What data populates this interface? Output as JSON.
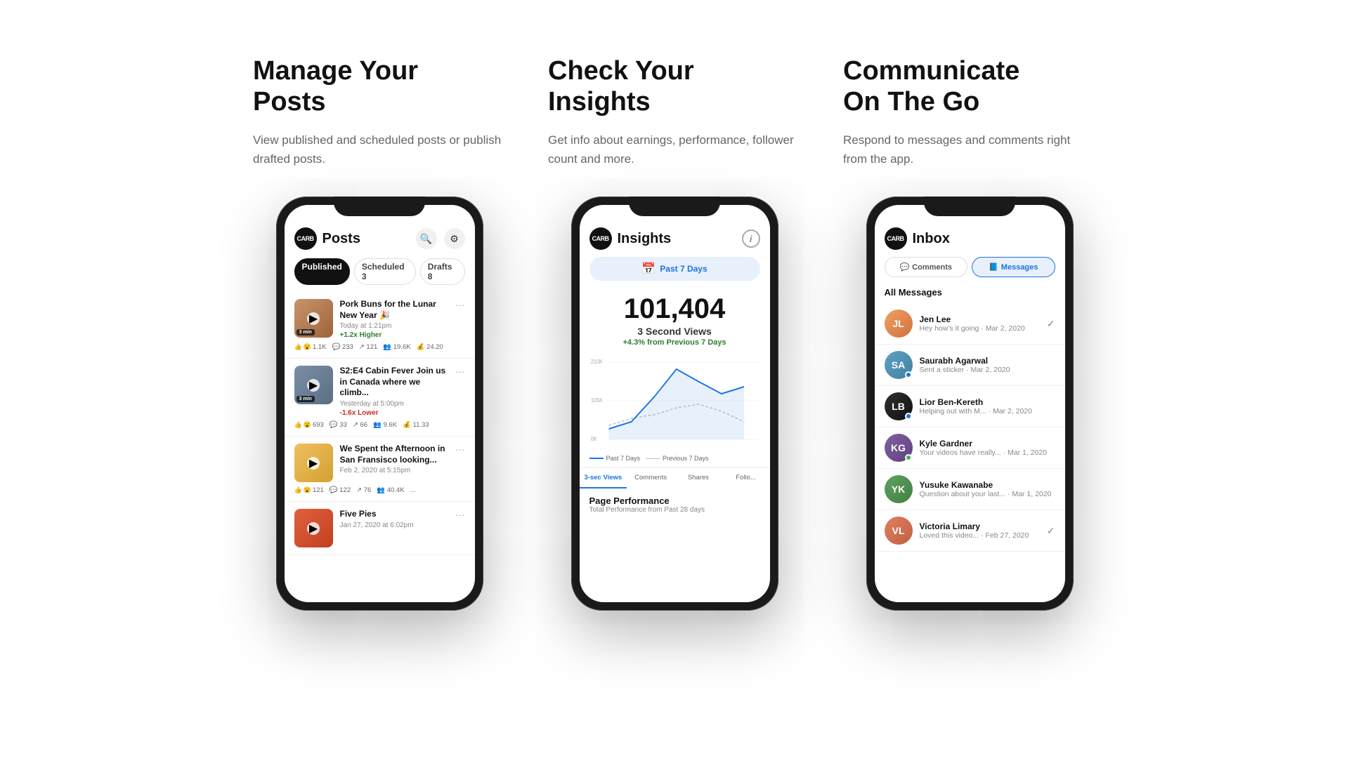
{
  "sections": [
    {
      "id": "manage-posts",
      "title": "Manage Your\nPosts",
      "description": "View published and scheduled posts or publish drafted posts."
    },
    {
      "id": "check-insights",
      "title": "Check Your\nInsights",
      "description": "Get info about earnings, performance, follower count and more."
    },
    {
      "id": "communicate",
      "title": "Communicate\nOn The Go",
      "description": "Respond to messages and comments right from the app."
    }
  ],
  "posts_phone": {
    "logo": "CARB",
    "title": "Posts",
    "search_icon": "🔍",
    "filter_icon": "⚙",
    "tabs": [
      {
        "label": "Published",
        "active": true
      },
      {
        "label": "Scheduled 3",
        "active": false
      },
      {
        "label": "Drafts 8",
        "active": false
      }
    ],
    "posts": [
      {
        "title": "Pork Buns for the Lunar New Year 🎉",
        "date": "Today at 1:21pm",
        "performance": "+1.2x Higher",
        "perf_type": "high",
        "thumb_type": "brown",
        "duration": "3 min",
        "stats": "👍😮 1.1K  💬 233  ↗ 121  👥 19.6K  💰 24.20"
      },
      {
        "title": "S2:E4 Cabin Fever Join us in Canada where we climb...",
        "date": "Yesterday at 5:00pm",
        "performance": "-1.6x Lower",
        "perf_type": "low",
        "thumb_type": "blue-gray",
        "duration": "3 min",
        "stats": "👍😮 693  💬 33  ↗ 66  👥 9.6K  💰 11.33"
      },
      {
        "title": "We Spent the Afternoon in San Fransisco looking...",
        "date": "Feb 2, 2020 at 5:15pm",
        "performance": "",
        "perf_type": "",
        "thumb_type": "yellow",
        "duration": "",
        "stats": "👍😮 121  💬 122  ↗ 76  👥 40.4K  ..."
      },
      {
        "title": "Five Pies",
        "date": "Jan 27, 2020 at 6:02pm",
        "performance": "",
        "perf_type": "",
        "thumb_type": "red",
        "duration": "",
        "stats": ""
      }
    ]
  },
  "insights_phone": {
    "logo": "CARB",
    "title": "Insights",
    "date_range": "Past 7 Days",
    "big_number": "101,404",
    "big_label": "3 Second Views",
    "big_change": "+4.3% from Previous 7 Days",
    "chart": {
      "y_labels": [
        "210K",
        "105K",
        "0K"
      ],
      "legend": [
        "Past 7 Days",
        "Previous 7 Days"
      ]
    },
    "tabs": [
      "3-sec Views",
      "Comments",
      "Shares",
      "Follo..."
    ],
    "active_tab": "3-sec Views",
    "page_perf_title": "Page Performance",
    "page_perf_sub": "Total Performance from Past 28 days"
  },
  "inbox_phone": {
    "logo": "CARB",
    "title": "Inbox",
    "tabs": [
      {
        "label": "Comments",
        "icon": "💬",
        "active": false
      },
      {
        "label": "Messages",
        "icon": "📘",
        "active": true
      }
    ],
    "section_label": "All Messages",
    "messages": [
      {
        "name": "Jen Lee",
        "preview": "Hey how's it going · Mar 2, 2020",
        "avatar_class": "msg-avatar-1",
        "initials": "JL",
        "dot": "sent",
        "check": "✓"
      },
      {
        "name": "Saurabh Agarwal",
        "preview": "Sent a sticker · Mar 2, 2020",
        "avatar_class": "msg-avatar-2",
        "initials": "SA",
        "dot": "blue",
        "check": ""
      },
      {
        "name": "Lior Ben-Kereth",
        "preview": "Helping out with M... · Mar 2, 2020",
        "avatar_class": "msg-avatar-3",
        "initials": "LB",
        "dot": "blue",
        "check": ""
      },
      {
        "name": "Kyle Gardner",
        "preview": "Your videos have really... · Mar 1, 2020",
        "avatar_class": "msg-avatar-4",
        "initials": "KG",
        "dot": "green",
        "check": ""
      },
      {
        "name": "Yusuke Kawanabe",
        "preview": "Question about your last... · Mar 1, 2020",
        "avatar_class": "msg-avatar-5",
        "initials": "YK",
        "dot": "",
        "check": ""
      },
      {
        "name": "Victoria Limary",
        "preview": "Loved this video... · Feb 27, 2020",
        "avatar_class": "msg-avatar-6",
        "initials": "VL",
        "dot": "sent",
        "check": "✓"
      }
    ]
  }
}
